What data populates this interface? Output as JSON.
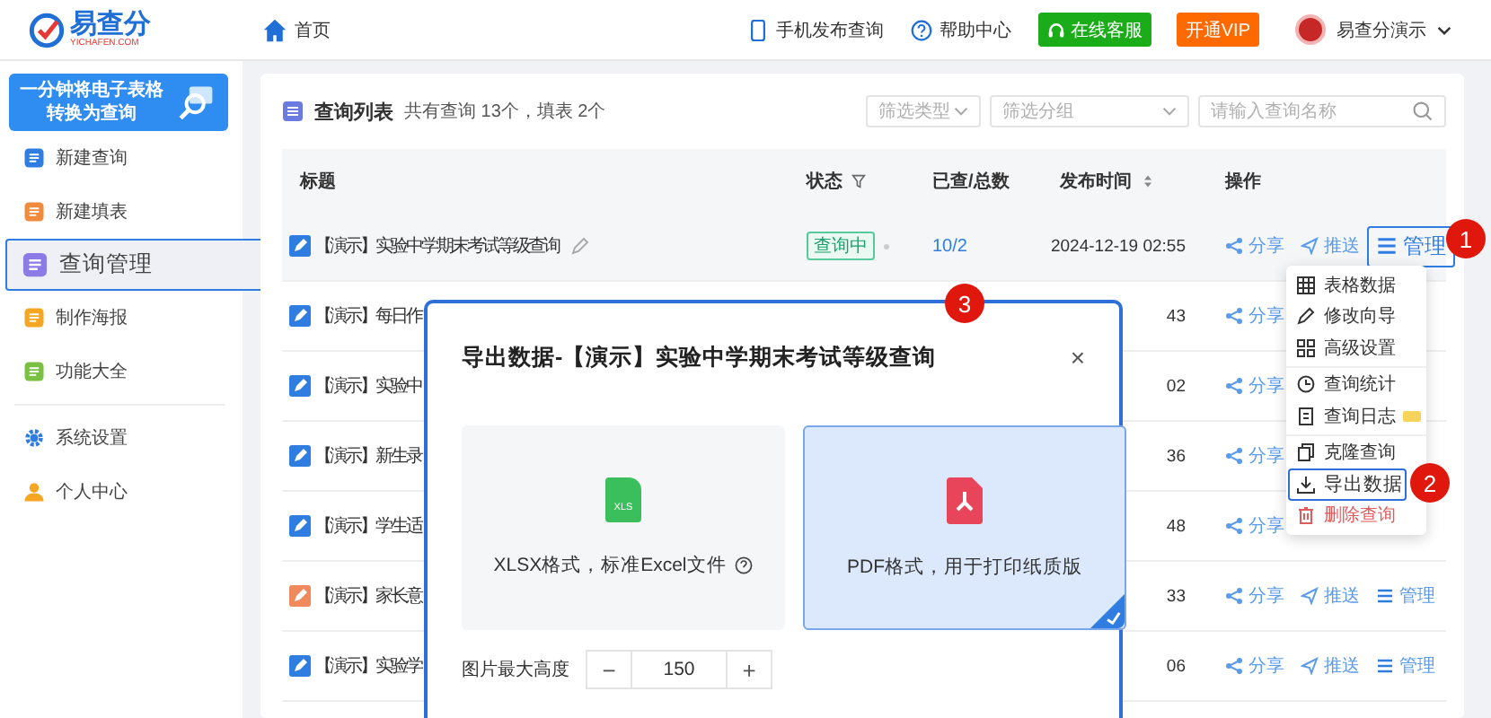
{
  "header": {
    "logo_text": "易查分",
    "logo_sub": "YICHAFEN.COM",
    "breadcrumb": "首页",
    "links": [
      {
        "kind": "phone",
        "label": "手机发布查询"
      },
      {
        "kind": "help",
        "label": "帮助中心"
      }
    ],
    "buttons": [
      {
        "kind": "service",
        "label": "在线客服"
      },
      {
        "kind": "vip",
        "label": "开通VIP"
      }
    ],
    "user": "易查分演示"
  },
  "sidebar": {
    "banner": [
      "一分钟将电子表格",
      "转换为查询"
    ],
    "items": [
      {
        "kind": "query",
        "label": "新建查询",
        "selected": false
      },
      {
        "kind": "form",
        "label": "新建填表",
        "selected": false
      },
      {
        "kind": "manage",
        "label": "查询管理",
        "selected": true
      },
      {
        "kind": "poster",
        "label": "制作海报",
        "selected": false
      },
      {
        "kind": "features",
        "label": "功能大全",
        "selected": false
      }
    ],
    "items2": [
      {
        "kind": "settings",
        "label": "系统设置",
        "selected": false
      },
      {
        "kind": "user",
        "label": "个人中心",
        "selected": false
      }
    ]
  },
  "card": {
    "title": "查询列表",
    "summary": "共有查询 13个，填表 2个",
    "filters": [
      {
        "placeholder": "筛选类型"
      },
      {
        "placeholder": "筛选分组"
      }
    ],
    "search": {
      "placeholder": "请输入查询名称"
    }
  },
  "table": {
    "columns": [
      {
        "label": "标题",
        "kind": "plain"
      },
      {
        "label": "状态",
        "kind": "filter"
      },
      {
        "label": "已查/总数",
        "kind": "plain"
      },
      {
        "label": "发布时间",
        "kind": "sort"
      },
      {
        "label": "操作",
        "kind": "plain"
      }
    ],
    "rows": [
      {
        "title": "【演示】实验中学期末考试等级查询",
        "color": "#2f7de1",
        "status": "查询中",
        "count": "10/2",
        "time": "2024-12-19 02:55",
        "actions": [
          {
            "kind": "share",
            "label": "分享"
          },
          {
            "kind": "push",
            "label": "推送"
          },
          {
            "kind": "manage",
            "label": "管理",
            "selected": true
          }
        ]
      },
      {
        "title": "【演示】每日作",
        "color": "#2f7de1",
        "time": "43",
        "actions": [
          {
            "kind": "share",
            "label": "分享"
          }
        ]
      },
      {
        "title": "【演示】实验中",
        "color": "#2f7de1",
        "time": "02",
        "actions": [
          {
            "kind": "share",
            "label": "分享"
          }
        ]
      },
      {
        "title": "【演示】新生录",
        "color": "#2f7de1",
        "time": "36",
        "actions": [
          {
            "kind": "share",
            "label": "分享"
          }
        ]
      },
      {
        "title": "【演示】学生适",
        "color": "#2f7de1",
        "time": "48",
        "actions": [
          {
            "kind": "share",
            "label": "分享"
          }
        ]
      },
      {
        "title": "【演示】家长意",
        "color": "#f08a5d",
        "time": "33",
        "actions": [
          {
            "kind": "share",
            "label": "分享"
          },
          {
            "kind": "push",
            "label": "推送"
          },
          {
            "kind": "manage",
            "label": "管理",
            "selected": false
          }
        ]
      },
      {
        "title": "【演示】实验学",
        "color": "#2f7de1",
        "time": "06",
        "actions": [
          {
            "kind": "share",
            "label": "分享"
          },
          {
            "kind": "push",
            "label": "推送"
          },
          {
            "kind": "manage",
            "label": "管理",
            "selected": false
          }
        ]
      }
    ]
  },
  "menu": {
    "groups": [
      [
        {
          "kind": "table",
          "label": "表格数据",
          "selected": false
        },
        {
          "kind": "edit",
          "label": "修改向导",
          "selected": false
        },
        {
          "kind": "grid",
          "label": "高级设置",
          "selected": false
        }
      ],
      [
        {
          "kind": "stats",
          "label": "查询统计",
          "selected": false
        },
        {
          "kind": "log",
          "label": "查询日志",
          "selected": false,
          "vip": true
        }
      ],
      [
        {
          "kind": "clone",
          "label": "克隆查询",
          "selected": false
        },
        {
          "kind": "export",
          "label": "导出数据",
          "selected": true
        },
        {
          "kind": "delete",
          "label": "删除查询",
          "selected": false
        }
      ]
    ]
  },
  "modal": {
    "title": "导出数据-【演示】实验中学期末考试等级查询",
    "close": "×",
    "options": [
      {
        "kind": "xlsx",
        "icon_text": "XLS",
        "label": "XLSX格式，标准Excel文件",
        "help": true,
        "selected": false
      },
      {
        "kind": "pdf",
        "label": "PDF格式，用于打印纸质版",
        "help": false,
        "selected": true
      }
    ],
    "stepper": {
      "label": "图片最大高度",
      "minus": "−",
      "value": "150",
      "plus": "+"
    }
  },
  "steps": [
    {
      "number": "1"
    },
    {
      "number": "2"
    },
    {
      "number": "3"
    }
  ]
}
